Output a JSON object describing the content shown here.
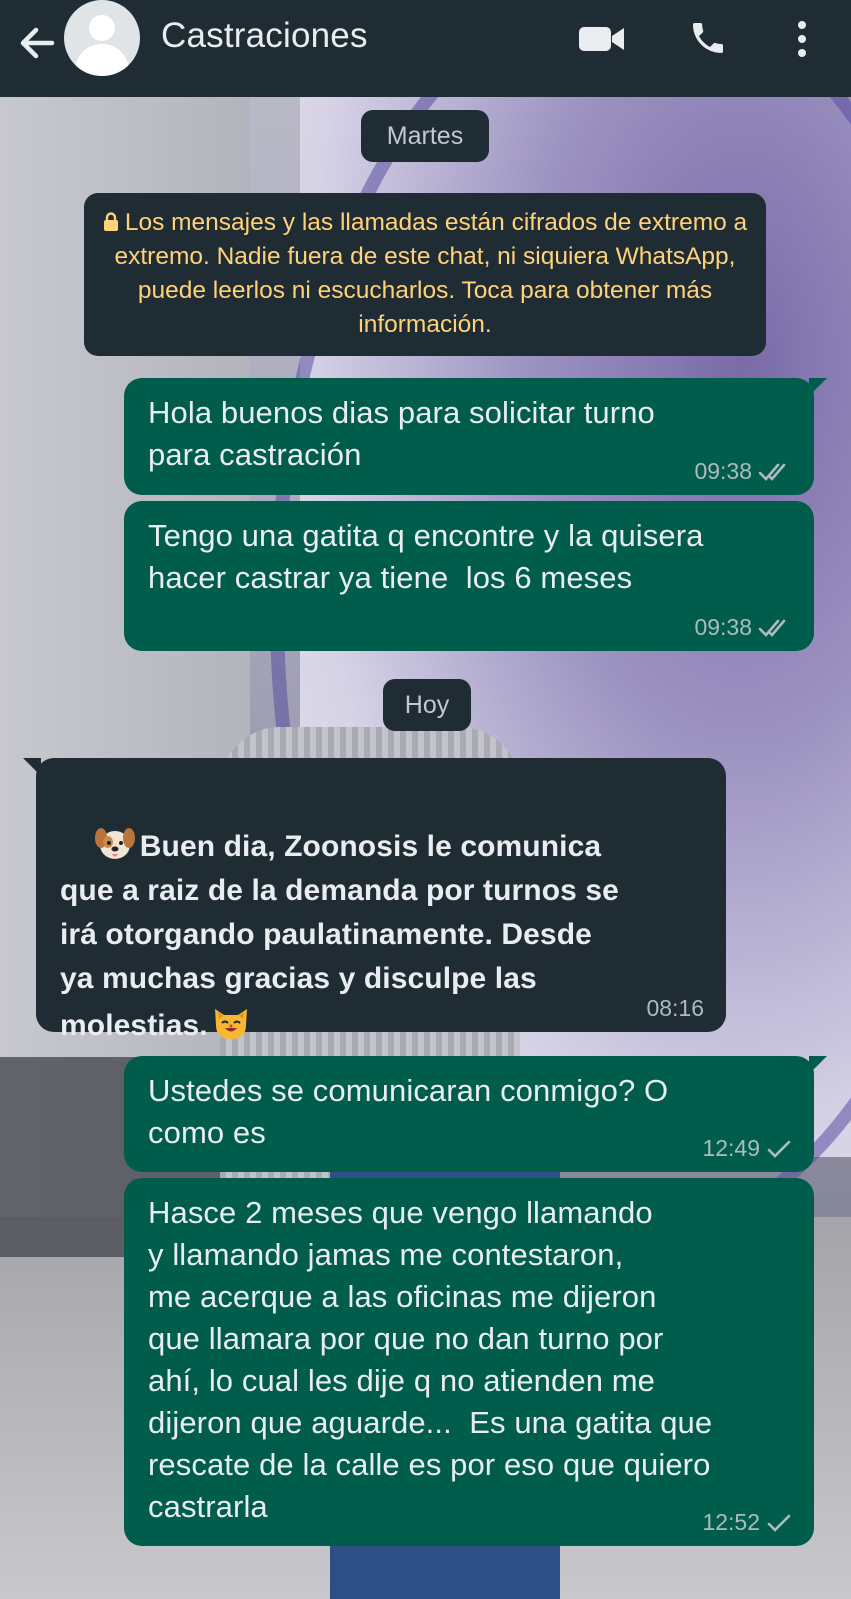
{
  "header": {
    "title": "Castraciones",
    "back_icon": "arrow-left-icon",
    "avatar_icon": "default-avatar-icon",
    "actions": [
      "video-call-icon",
      "phone-icon",
      "more-vertical-icon"
    ]
  },
  "chat": {
    "date_martes": "Martes",
    "encryption_notice": "Los mensajes y las llamadas están cifrados de extremo a extremo. Nadie fuera de este chat, ni siquiera WhatsApp, puede leerlos ni escucharlos. Toca para obtener más información.",
    "date_hoy": "Hoy",
    "messages": [
      {
        "direction": "out",
        "text": "Hola buenos dias para solicitar turno\npara castración",
        "time": "09:38",
        "status": "read"
      },
      {
        "direction": "out",
        "text": "Tengo una gatita q encontre y la quisera\nhacer castrar ya tiene  los 6 meses",
        "time": "09:38",
        "status": "read"
      },
      {
        "direction": "in",
        "text_before_emoji": "Buen dia, Zoonosis le comunica\nque a raiz de la demanda por turnos se\nirá otorgando paulatinamente. Desde\nya muchas gracias y disculpe las\nmolestias.",
        "emoji_start": "dog-face-emoji",
        "emoji_end": "cat-face-emoji",
        "time": "08:16"
      },
      {
        "direction": "out",
        "text": "Ustedes se comunicaran conmigo? O\ncomo es",
        "time": "12:49",
        "status": "sent"
      },
      {
        "direction": "out",
        "text": "Hasce 2 meses que vengo llamando\ny llamando jamas me contestaron,\nme acerque a las oficinas me dijeron\nque llamara por que no dan turno por\nahí, lo cual les dije q no atienden me\ndijeron que aguarde...  Es una gatita que\nrescate de la calle es por eso que quiero\ncastrarla",
        "time": "12:52",
        "status": "sent"
      }
    ]
  },
  "colors": {
    "header_bg": "#1f2c34",
    "outgoing_bubble": "#005c4b",
    "incoming_bubble": "#1f2c34",
    "notice_text": "#ffd279"
  }
}
